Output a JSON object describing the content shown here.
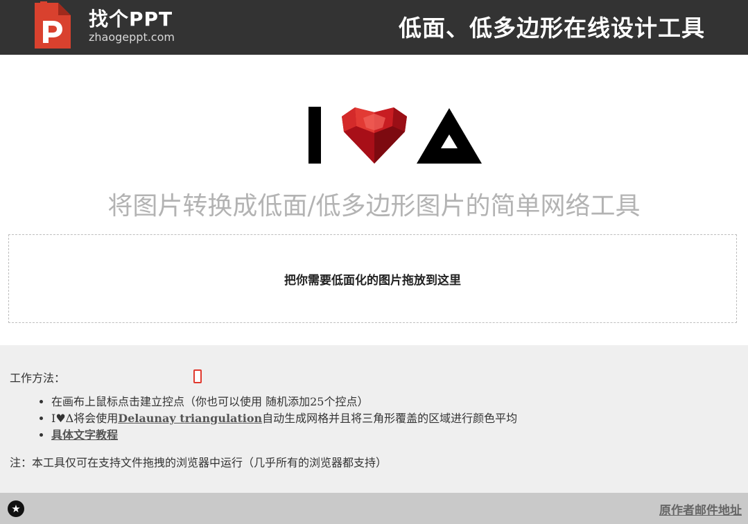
{
  "header": {
    "logo_name": "找个PPT",
    "logo_domain": "zhaogeppt.com",
    "title": "低面、低多边形在线设计工具",
    "background": "#333333"
  },
  "hero": {
    "letter": "I",
    "icons": [
      "red-faceted-heart-icon",
      "black-triangle-icon"
    ],
    "accent": "#c8141c"
  },
  "subtitle": "将图片转换成低面/低多边形图片的简单网络工具",
  "dropzone": {
    "label": "把你需要低面化的图片拖放到这里"
  },
  "info": {
    "method_label": "工作方法：",
    "bullets": [
      {
        "text": "在画布上鼠标点击建立控点（你也可以使用 随机添加25个控点）"
      },
      {
        "prefix": "I♥Δ将会使用",
        "link": "Delaunay triangulation",
        "suffix": "自动生成网格并且将三角形覆盖的区域进行颜色平均"
      },
      {
        "link": "具体文字教程"
      }
    ],
    "note": "注：本工具仅可在支持文件拖拽的浏览器中运行（几乎所有的浏览器都支持）"
  },
  "footer": {
    "badge_icon": "star-icon",
    "link": "原作者邮件地址"
  }
}
